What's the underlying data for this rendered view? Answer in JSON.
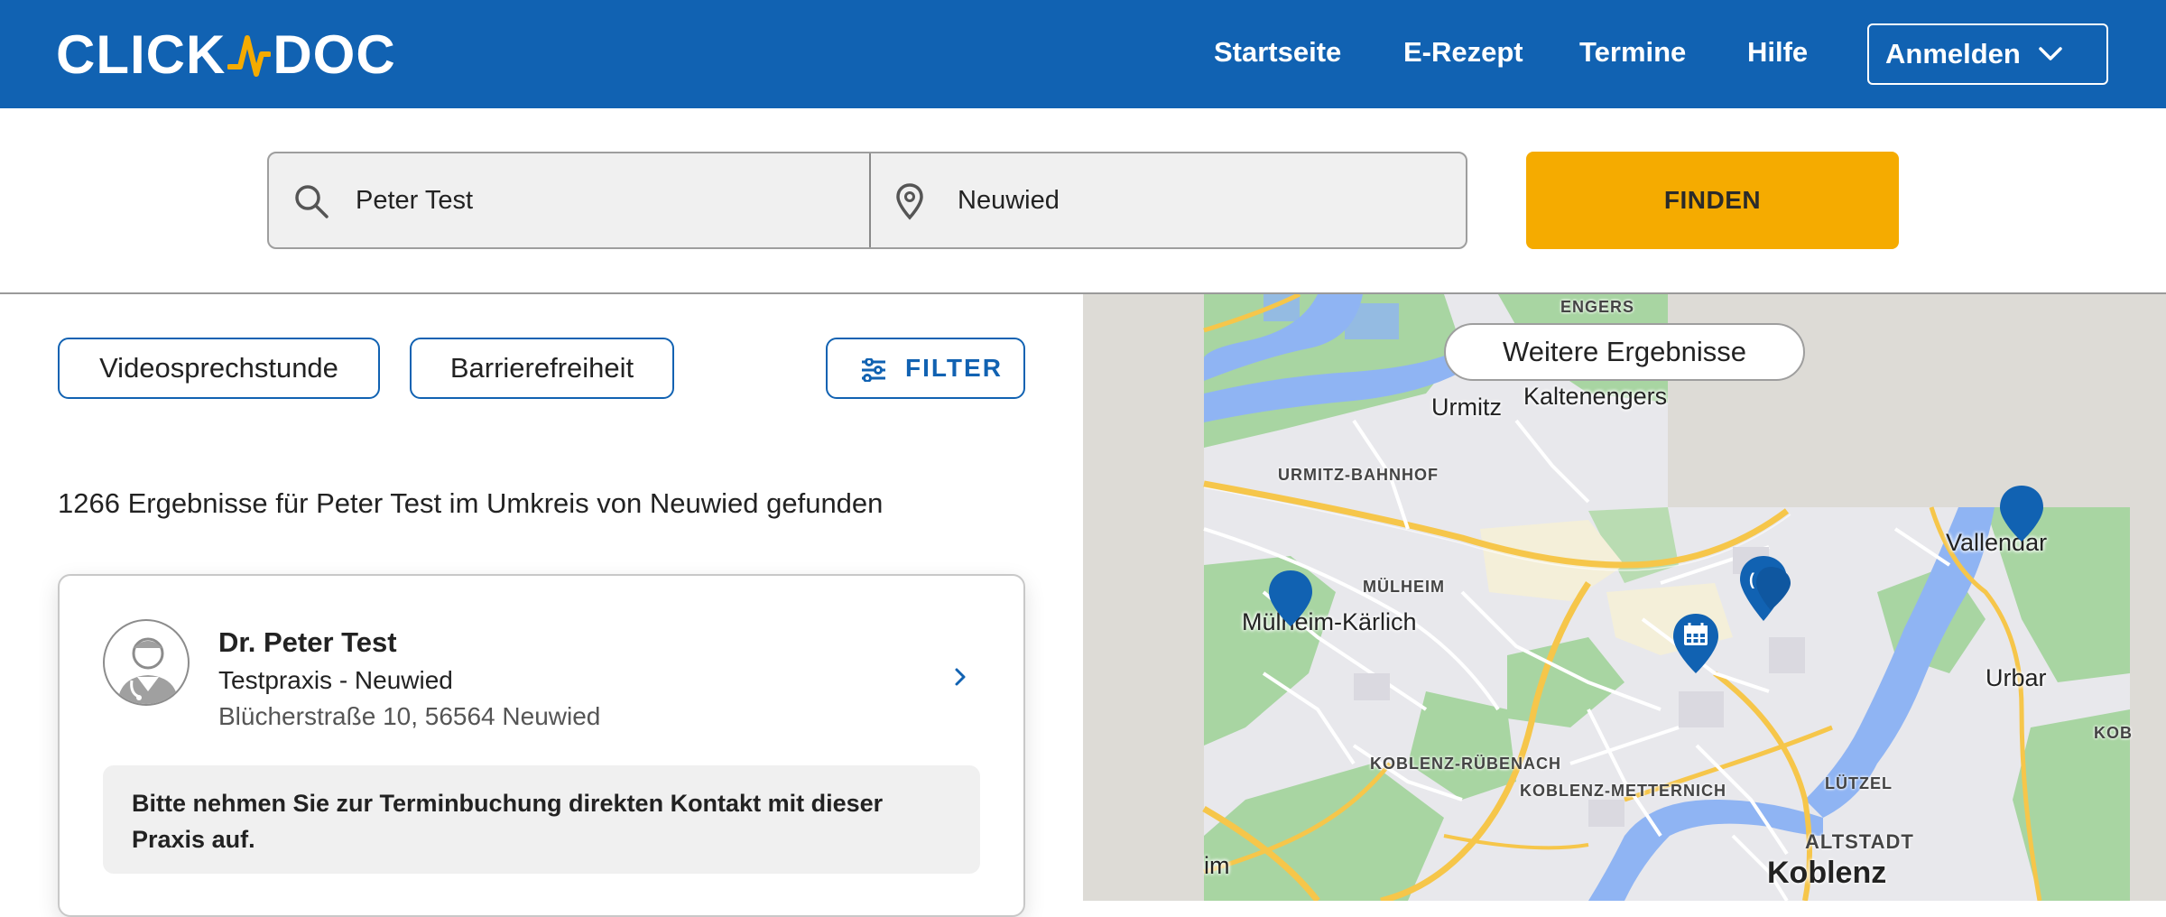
{
  "header": {
    "logo_left": "CLICK",
    "logo_right": "DOC",
    "nav": [
      "Startseite",
      "E-Rezept",
      "Termine",
      "Hilfe"
    ],
    "login_label": "Anmelden",
    "bg_color": "#1162b2"
  },
  "search": {
    "query_value": "Peter Test",
    "location_value": "Neuwied",
    "find_label": "FINDEN",
    "find_color": "#f5ab00"
  },
  "filters": {
    "chips": [
      "Videosprechstunde",
      "Barrierefreiheit"
    ],
    "filter_label": "FILTER"
  },
  "results": {
    "summary": "1266 Ergebnisse für Peter Test im Umkreis von Neuwied gefunden",
    "cards": [
      {
        "name": "Dr. Peter Test",
        "practice": "Testpraxis - Neuwied",
        "address": "Blücherstraße 10, 56564 Neuwied",
        "notice": "Bitte nehmen Sie zur Terminbuchung direkten Kontakt mit dieser Praxis auf."
      }
    ]
  },
  "map": {
    "more_results_label": "Weitere Ergebnisse",
    "district_labels": [
      "ENGERS",
      "URMITZ-BAHNHOF",
      "MÜLHEIM",
      "KOBLENZ-RÜBENACH",
      "KOBLENZ-METTERNICH",
      "LÜTZEL",
      "ALTSTADT",
      "KOB"
    ],
    "town_labels": [
      "Urmitz",
      "Kaltenengers",
      "Mülheim-Kärlich",
      "Vallendar",
      "Urbar",
      "im"
    ],
    "city_label": "Koblenz"
  }
}
